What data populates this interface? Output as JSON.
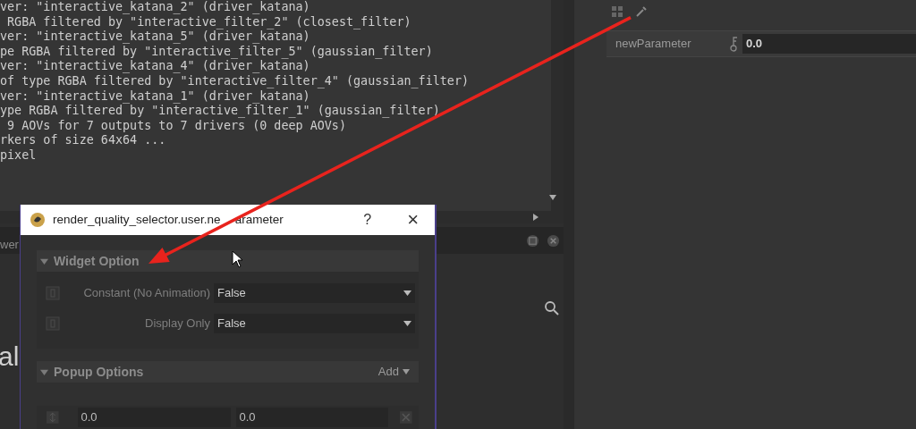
{
  "log": {
    "lines": [
      "ver: \"interactive_katana_2\" (driver_katana)",
      " RGBA filtered by \"interactive_filter_2\" (closest_filter)",
      "ver: \"interactive_katana_5\" (driver_katana)",
      "pe RGBA filtered by \"interactive_filter_5\" (gaussian_filter)",
      "ver: \"interactive_katana_4\" (driver_katana)",
      "of type RGBA filtered by \"interactive_filter_4\" (gaussian_filter)",
      "ver: \"interactive_katana_1\" (driver_katana)",
      "ype RGBA filtered by \"interactive_filter_1\" (gaussian_filter)",
      " 9 AOVs for 7 outputs to 7 drivers (0 deep AOVs)",
      "rkers of size 64x64 ...",
      "pixel"
    ]
  },
  "parameters_panel": {
    "parameter": {
      "label": "newParameter",
      "value": "0.0"
    }
  },
  "background_panel": {
    "tab_fragment": "wer",
    "text_fragment": "al"
  },
  "dialog": {
    "title_parts": [
      "render_quality_selector.user.ne",
      "arameter"
    ],
    "help": "?",
    "close": "×",
    "sections": [
      {
        "kind": "options",
        "title": "Widget Option",
        "expanded": true,
        "rows": [
          {
            "label": "Constant (No Animation)",
            "value": "False"
          },
          {
            "label": "Display Only",
            "value": "False"
          }
        ]
      },
      {
        "kind": "popup",
        "title": "Popup Options",
        "expanded": true,
        "action": "Add",
        "fields": [
          "0.0",
          "0.0"
        ]
      }
    ]
  }
}
